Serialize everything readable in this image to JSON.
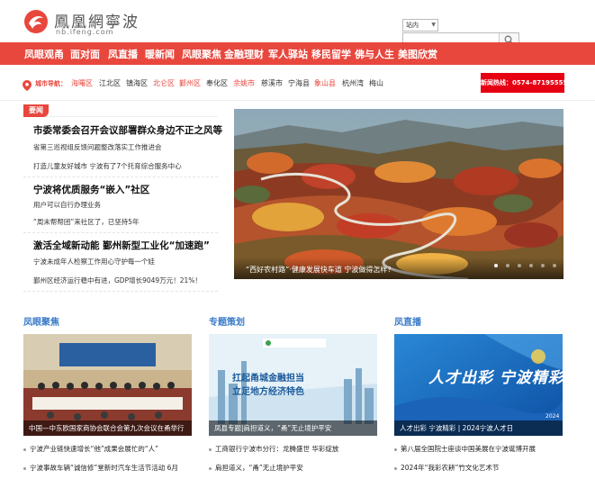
{
  "header": {
    "logo_cn": "鳳凰網寧波",
    "logo_en": "nb.ifeng.com",
    "site_select": "站内",
    "search_placeholder": ""
  },
  "nav": {
    "items": [
      "凤眼观甬",
      "面对面",
      "凤直播",
      "暖新闻",
      "凤眼聚焦",
      "金融理财",
      "军人驿站",
      "移民留学",
      "佛与人生",
      "美图欣赏"
    ]
  },
  "city": {
    "label": "城市导航：",
    "links": [
      {
        "text": "海曙区",
        "color": "#e8473d"
      },
      {
        "text": "江北区",
        "color": "#333333"
      },
      {
        "text": "镇海区",
        "color": "#333333"
      },
      {
        "text": "北仑区",
        "color": "#e8473d"
      },
      {
        "text": "鄞州区",
        "color": "#e8473d"
      },
      {
        "text": "奉化区",
        "color": "#333333"
      },
      {
        "text": "余姚市",
        "color": "#e8473d"
      },
      {
        "text": "慈溪市",
        "color": "#333333"
      },
      {
        "text": "宁海县",
        "color": "#333333"
      },
      {
        "text": "象山县",
        "color": "#e8473d"
      },
      {
        "text": "杭州湾",
        "color": "#333333"
      },
      {
        "text": "梅山",
        "color": "#333333"
      }
    ],
    "hotline": "新闻热线：0574-87195555"
  },
  "focus": {
    "tag": "要闻",
    "groups": [
      {
        "headline": "市委常委会召开会议部署群众身边不正之风等",
        "sublines": [
          "省第三巡视组反馈问题整改落实工作推进会",
          "打造儿童友好城市 宁波有了7个托育综合服务中心"
        ]
      },
      {
        "headline": "宁波将优质服务“嵌入”社区",
        "sublines": [
          "用户可以自行办理业务",
          "“周末帮帮团”来社区了，已坚持5年"
        ]
      },
      {
        "headline": "激活全域新动能 鄞州新型工业化“加速跑”",
        "sublines": [
          "宁波未成年人检察工作用心守护每一个娃",
          "鄞州区经济运行稳中有进，GDP增长9049万元！21%！"
        ]
      }
    ]
  },
  "hero": {
    "caption": "“西好农村路”·健康发展快车道 宁波做得怎样？",
    "dot_count": 6,
    "active_dot": 0
  },
  "columns": [
    {
      "title": "凤眼聚焦",
      "image_caption": "中国—中东欧国家商协会联合会第九次会议在甬举行",
      "items": [
        "宁波产业链快速增长“他”成果会展忙的“人”",
        "宁波事故车辆“诚信修”堂新时汽车生活节活动 6月"
      ]
    },
    {
      "title": "专题策划",
      "image_caption": "凤县专题|肩担道义，“甬”无止境护平安",
      "banner_line1": "扛起甬城金融担当",
      "banner_line2": "立足地方经济特色",
      "items": [
        "工商银行宁波市分行：龙腾盛世 华彩绽放",
        "肩担道义，“甬”无止境护平安"
      ]
    },
    {
      "title": "凤直播",
      "image_caption": "人才出彩 宁波精彩 | 2024宁波人才日",
      "banner_text": "人才出彩 宁波精彩",
      "banner_year": "2024",
      "items": [
        "第八届全国院士座谈中国美展在宁波诞博开展",
        "2024年“我彩农耕”竹文化艺术节"
      ]
    }
  ],
  "colors": {
    "brand_red": "#e8473d",
    "hotline_red": "#e60012",
    "section_blue": "#3a7bc8"
  }
}
